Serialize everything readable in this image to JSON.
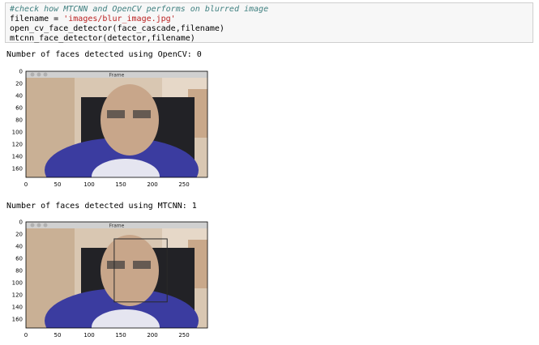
{
  "code_cell": {
    "comment": "#check how MTCNN and OpenCV performs on blurred image",
    "line2_prefix": "filename = ",
    "line2_string": "'images/blur_image.jpg'",
    "line3": "open_cv_face_detector(face_cascade,filename)",
    "line4": "mtcnn_face_detector(detector,filename)"
  },
  "outputs": [
    {
      "text": "Number of faces detected using OpenCV: 0",
      "frame_title": "Frame",
      "y_ticks": [
        "0",
        "20",
        "40",
        "60",
        "80",
        "100",
        "120",
        "140",
        "160"
      ],
      "x_ticks": [
        "0",
        "50",
        "100",
        "150",
        "200",
        "250"
      ],
      "face_boxes": []
    },
    {
      "text": "Number of faces detected using MTCNN: 1",
      "frame_title": "Frame",
      "y_ticks": [
        "0",
        "20",
        "40",
        "60",
        "80",
        "100",
        "120",
        "140",
        "160"
      ],
      "x_ticks": [
        "0",
        "50",
        "100",
        "150",
        "200",
        "250"
      ],
      "face_boxes": [
        {
          "x0": 140,
          "y0": 28,
          "x1": 224,
          "y1": 132
        }
      ]
    }
  ],
  "colors": {
    "box": "#2a2a2a",
    "shirt": "#3b3ca0",
    "skin": "#c8a68a",
    "wall": "#d9c7b2"
  }
}
